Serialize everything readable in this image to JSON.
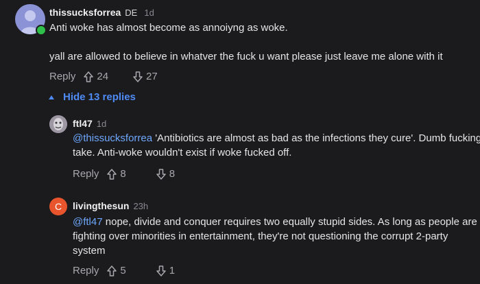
{
  "comments": [
    {
      "username": "thissucksforrea",
      "flag": "DE",
      "time": "1d",
      "lines": [
        "Anti woke has almost become as annoiyng as woke.",
        "yall are allowed to believe in whatver the fuck u want please just leave me alone with it"
      ],
      "reply_label": "Reply",
      "upvotes": "24",
      "downvotes": "27"
    },
    {
      "username": "ftl47",
      "time": "1d",
      "mention": "@thissucksforrea",
      "text_line1": " 'Antibiotics are almost as bad as the infections they cure'. Dumb fucking",
      "text_line2": "take. Anti-woke wouldn't exist if woke fucked off.",
      "reply_label": "Reply",
      "upvotes": "8",
      "downvotes": "8"
    },
    {
      "username": "livingthesun",
      "time": "23h",
      "avatar_letter": "C",
      "mention": "@ftl47",
      "text_line1": " nope, divide and conquer requires two equally stupid sides. As long as people are",
      "text_line2": "fighting over minorities in entertainment, they're not questioning the corrupt 2-party",
      "text_line3": "system",
      "reply_label": "Reply",
      "upvotes": "5",
      "downvotes": "1"
    }
  ],
  "hide_replies_label": "Hide 13 replies",
  "colors": {
    "background": "#1b1b1d",
    "link": "#4f8bf6",
    "mention": "#6ea8ff",
    "online": "#2fbf4a",
    "avatar_orange": "#e8552d"
  }
}
